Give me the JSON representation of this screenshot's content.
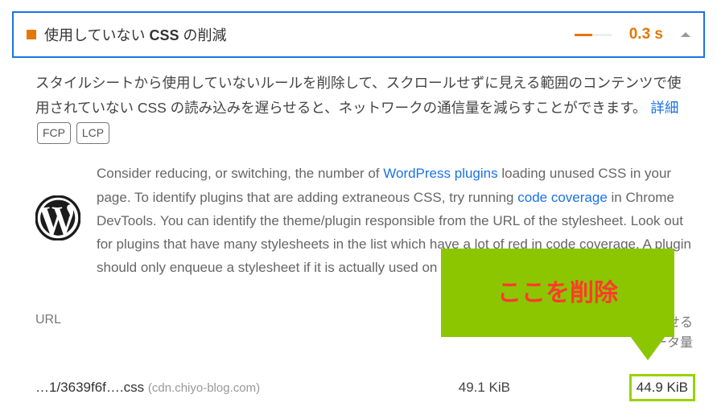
{
  "header": {
    "title_before": "使用していない ",
    "title_bold": "CSS",
    "title_after": " の削減",
    "metric": "0.3 s"
  },
  "description": {
    "text_before": "スタイルシートから使用していないルールを削除して、スクロールせずに見える範囲のコンテンツで使用されていない CSS の読み込みを遅らせると、ネットワークの通信量を減らすことができます。",
    "details_link": "詳細",
    "tag_fcp": "FCP",
    "tag_lcp": "LCP"
  },
  "suggestion": {
    "part1": "Consider reducing, or switching, the number of ",
    "link1": "WordPress plugins",
    "part2": " loading unused CSS in your page. To identify plugins that are adding extraneous CSS, try running ",
    "link2": "code coverage",
    "part3": " in Chrome DevTools. You can identify the theme/plugin responsible from the URL of the stylesheet. Look out for plugins that have many stylesheets in the list which have a lot of red in code coverage. A plugin should only enqueue a stylesheet if it is actually used on the page."
  },
  "table": {
    "head_url": "URL",
    "head_save": "減らせる\nデータ量",
    "row_file": "…1/3639f6f….css",
    "row_origin": "(cdn.chiyo-blog.com)",
    "row_size": "49.1 KiB",
    "row_savings": "44.9 KiB"
  },
  "callout": "ここを削除"
}
